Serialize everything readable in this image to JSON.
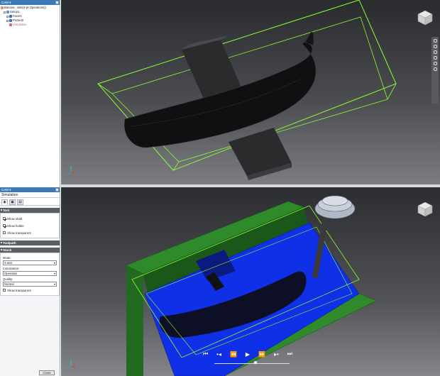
{
  "browser": {
    "title": "CAM",
    "items": [
      {
        "label": "Banana - side(4-pt Operations))",
        "level": 0
      },
      {
        "label": "Setup1",
        "level": 1
      },
      {
        "label": "Facet1",
        "level": 2
      },
      {
        "label": "Pocket2",
        "level": 2
      },
      {
        "label": "Simulation",
        "level": 2
      }
    ]
  },
  "simulation": {
    "panel_title": "CAM",
    "title": "Simulation",
    "tool_section": "Tool",
    "show_shaft": "Show shaft",
    "show_holder": "Show holder",
    "show_transparent": "Show transparent",
    "toolpath_section": "Toolpath",
    "stock_section": "Stock",
    "mode_label": "Mode:",
    "mode_value": "3-axis",
    "colorization_label": "Colorization:",
    "colorization_value": "Operation",
    "quality_label": "Quality:",
    "quality_value": "Normal",
    "stock_transparent": "Show transparent",
    "close_label": "Close"
  },
  "player": {
    "position": 0.55
  },
  "colors": {
    "stock_blue": "#1030e8",
    "fixture_green": "#2e8a2a",
    "wire_green": "#88ff33",
    "banana": "#101012"
  }
}
